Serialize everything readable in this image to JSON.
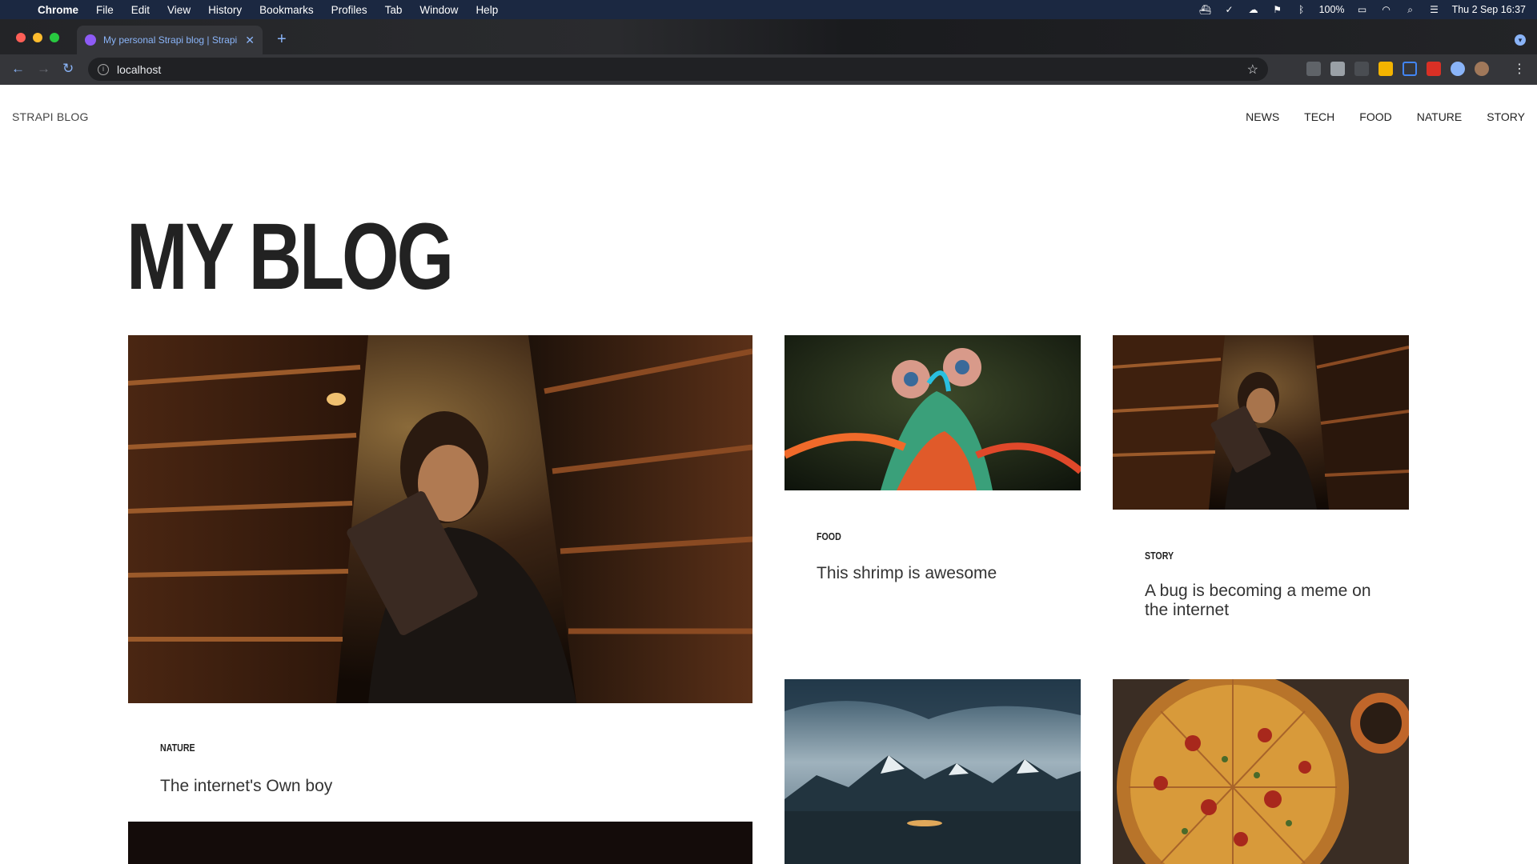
{
  "menubar": {
    "app_name": "Chrome",
    "menus": [
      "File",
      "Edit",
      "View",
      "History",
      "Bookmarks",
      "Profiles",
      "Tab",
      "Window",
      "Help"
    ],
    "battery": "100%",
    "clock": "Thu 2 Sep  16:37"
  },
  "browser": {
    "tab_title": "My personal Strapi blog | Strapi",
    "url": "localhost"
  },
  "site": {
    "brand": "STRAPI BLOG",
    "nav": [
      "NEWS",
      "TECH",
      "FOOD",
      "NATURE",
      "STORY"
    ],
    "heading": "MY BLOG"
  },
  "articles": [
    {
      "category": "NATURE",
      "title": "The internet's Own boy"
    },
    {
      "category": "FOOD",
      "title": "This shrimp is awesome"
    },
    {
      "category": "STORY",
      "title": "A bug is becoming a meme on the internet"
    }
  ],
  "colors": {
    "menubar": "#1b2841",
    "accent": "#8ab4f8",
    "favicon": "#8e5bf6"
  }
}
